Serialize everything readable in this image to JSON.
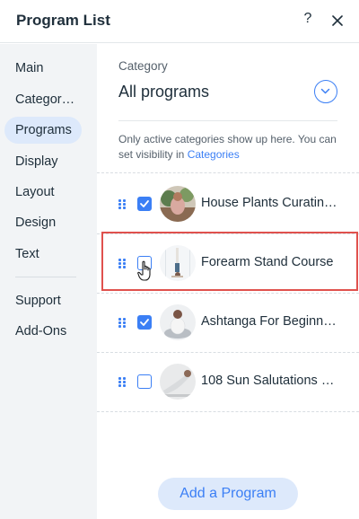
{
  "header": {
    "title": "Program List",
    "help_label": "?"
  },
  "sidebar": {
    "items": [
      {
        "label": "Main"
      },
      {
        "label": "Categor…"
      },
      {
        "label": "Programs",
        "active": true
      },
      {
        "label": "Display"
      },
      {
        "label": "Layout"
      },
      {
        "label": "Design"
      },
      {
        "label": "Text"
      },
      {
        "label": "Support"
      },
      {
        "label": "Add-Ons"
      }
    ]
  },
  "category": {
    "label": "Category",
    "value": "All programs",
    "info_text": "Only active categories show up here. You can set visibility in ",
    "info_link": "Categories"
  },
  "programs": [
    {
      "name": "House Plants Curating…",
      "checked": true
    },
    {
      "name": "Forearm Stand Course",
      "checked": false,
      "highlighted": true
    },
    {
      "name": "Ashtanga For Beginners",
      "checked": true
    },
    {
      "name": "108 Sun Salutations C…",
      "checked": false
    }
  ],
  "add_button": "Add a Program",
  "colors": {
    "accent": "#3b7ff5",
    "highlight": "#e0514d",
    "sidebar_bg": "#f2f4f6",
    "active_bg": "#dde9fb"
  }
}
